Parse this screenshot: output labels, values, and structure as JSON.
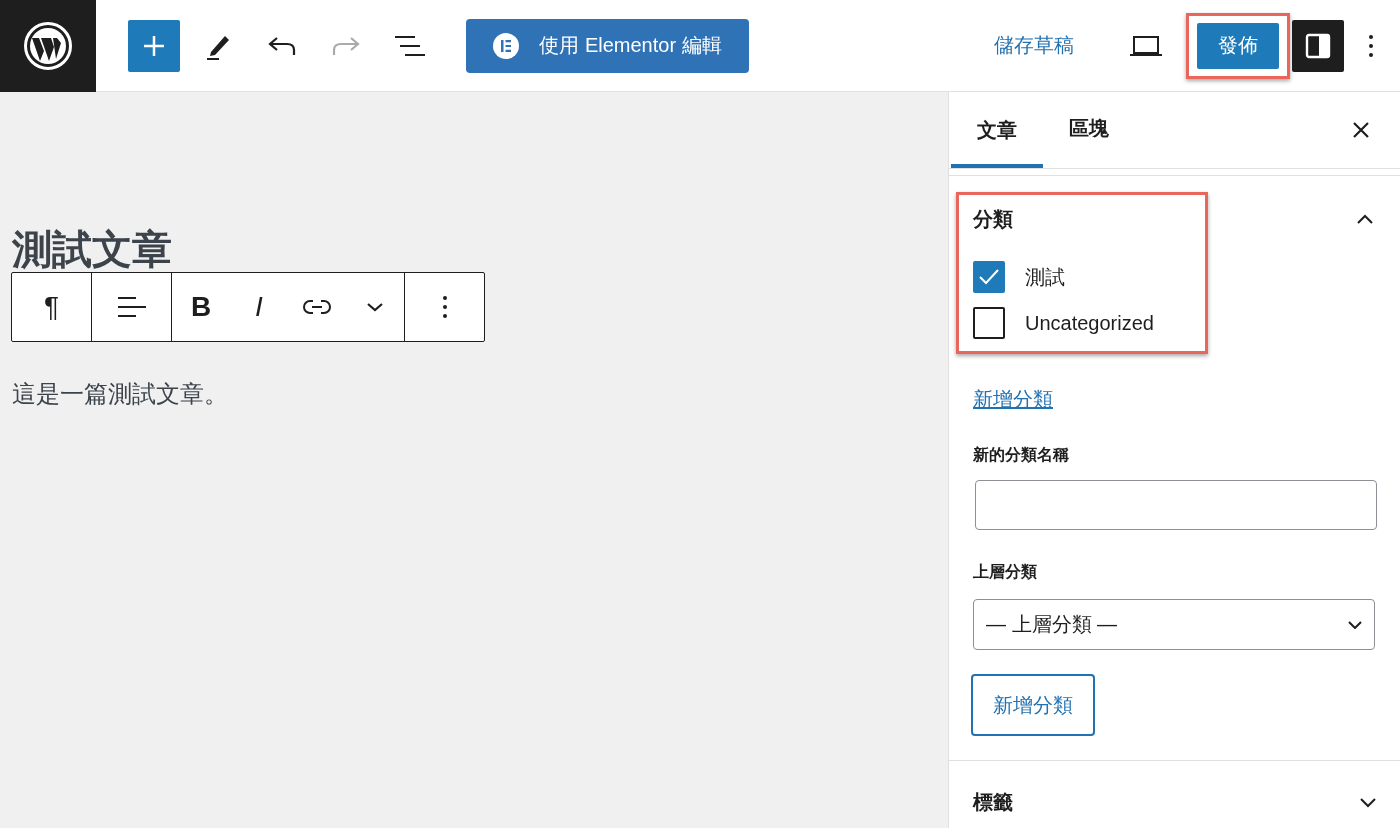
{
  "topbar": {
    "elementor_button": "使用 Elementor 編輯",
    "save_draft": "儲存草稿",
    "publish": "發佈"
  },
  "editor": {
    "title": "測試文章",
    "toolbar": [
      {
        "kind": "glyph",
        "label": "¶"
      },
      {
        "kind": "glyph",
        "label": "B"
      },
      {
        "kind": "glyph",
        "label": "I"
      }
    ],
    "paragraph": "這是一篇測試文章。"
  },
  "sidebar": {
    "tabs": [
      {
        "label": "文章",
        "selected": true
      },
      {
        "label": "區塊",
        "selected": false
      }
    ],
    "categories": {
      "title": "分類",
      "expanded": true,
      "items": [
        {
          "label": "測試",
          "checked": true
        },
        {
          "label": "Uncategorized",
          "checked": false
        }
      ],
      "add_link": "新增分類",
      "new_name_label": "新的分類名稱",
      "parent_label": "上層分類",
      "parent_select": "— 上層分類 —",
      "add_button": "新增分類"
    },
    "tags": {
      "title": "標籤",
      "expanded": false
    }
  }
}
